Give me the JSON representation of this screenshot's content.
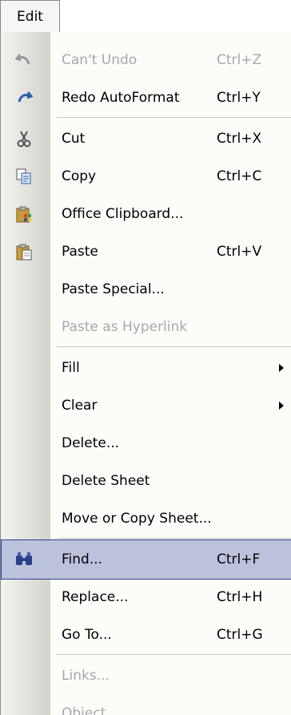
{
  "menubar": {
    "title": "Edit"
  },
  "menu": {
    "items": [
      {
        "label": "Can't Undo",
        "shortcut": "Ctrl+Z",
        "icon": "undo-icon",
        "disabled": true
      },
      {
        "label": "Redo AutoFormat",
        "shortcut": "Ctrl+Y",
        "icon": "redo-icon"
      },
      {
        "label": "Cut",
        "shortcut": "Ctrl+X",
        "icon": "scissors-icon"
      },
      {
        "label": "Copy",
        "shortcut": "Ctrl+C",
        "icon": "copy-icon"
      },
      {
        "label": "Office Clipboard...",
        "shortcut": "",
        "icon": "office-clipboard-icon"
      },
      {
        "label": "Paste",
        "shortcut": "Ctrl+V",
        "icon": "paste-icon"
      },
      {
        "label": "Paste Special...",
        "shortcut": ""
      },
      {
        "label": "Paste as Hyperlink",
        "shortcut": "",
        "disabled": true
      },
      {
        "label": "Fill",
        "submenu": true
      },
      {
        "label": "Clear",
        "submenu": true
      },
      {
        "label": "Delete...",
        "shortcut": ""
      },
      {
        "label": "Delete Sheet",
        "shortcut": ""
      },
      {
        "label": "Move or Copy Sheet...",
        "shortcut": ""
      },
      {
        "label": "Find...",
        "shortcut": "Ctrl+F",
        "icon": "binoculars-icon",
        "highlighted": true
      },
      {
        "label": "Replace...",
        "shortcut": "Ctrl+H"
      },
      {
        "label": "Go To...",
        "shortcut": "Ctrl+G"
      },
      {
        "label": "Links...",
        "shortcut": "",
        "disabled": true
      },
      {
        "label": "Object",
        "shortcut": "",
        "disabled": true
      }
    ]
  },
  "colors": {
    "highlight_fill": "#bcc2dc",
    "highlight_border": "#2c3f8c",
    "disabled_text": "#a8a8a8"
  }
}
